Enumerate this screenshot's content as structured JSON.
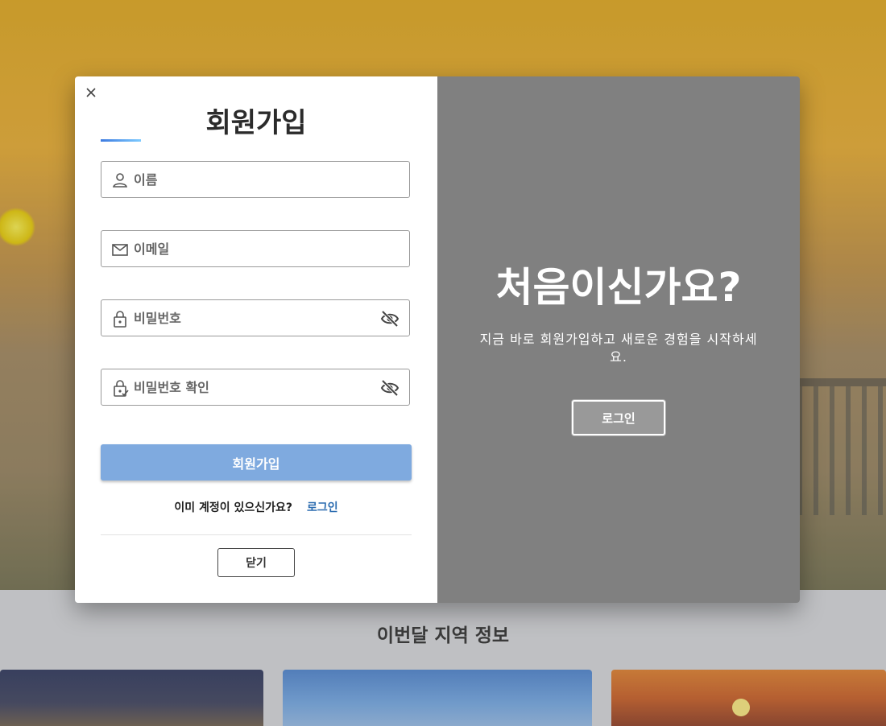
{
  "background": {
    "section_title": "이번달 지역 정보"
  },
  "signup": {
    "title": "회원가입",
    "fields": {
      "name_placeholder": "이름",
      "email_placeholder": "이메일",
      "password_placeholder": "비밀번호",
      "password_confirm_placeholder": "비밀번호 확인"
    },
    "submit_label": "회원가입",
    "have_account_text": "이미 계정이 있으신가요?",
    "login_link": "로그인",
    "close_label": "닫기"
  },
  "welcome": {
    "title": "처음이신가요?",
    "subtitle": "지금 바로 회원가입하고 새로운 경험을 시작하세요.",
    "login_button": "로그인"
  },
  "colors": {
    "accent": "#7faadf",
    "link": "#2b6cb0",
    "panel": "#808080"
  }
}
